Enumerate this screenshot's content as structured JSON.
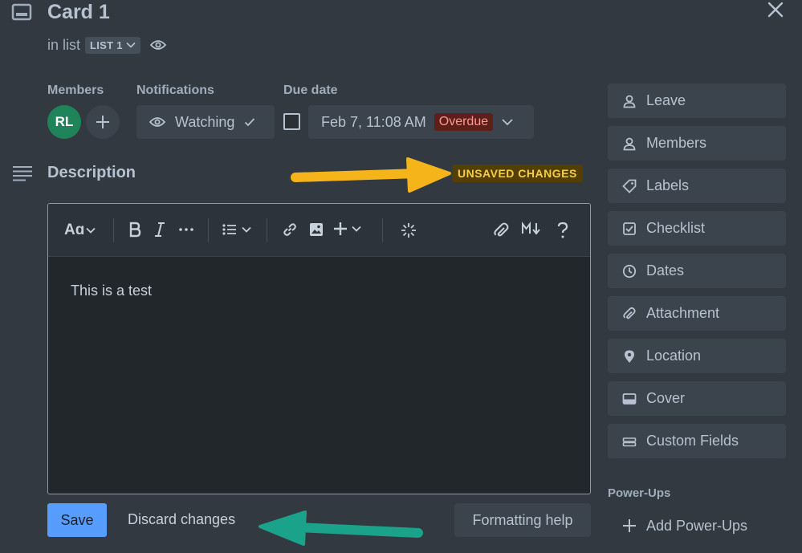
{
  "card": {
    "title": "Card 1",
    "in_list_prefix": "in list",
    "list_name": "LIST 1"
  },
  "members": {
    "label": "Members",
    "avatar_initials": "RL",
    "avatar_color": "#1f845a"
  },
  "notifications": {
    "label": "Notifications",
    "watch_label": "Watching"
  },
  "due_date": {
    "label": "Due date",
    "value": "Feb 7, 11:08 AM",
    "status": "Overdue",
    "checked": false
  },
  "description": {
    "title": "Description",
    "unsaved_badge": "UNSAVED CHANGES",
    "text": "This is a test"
  },
  "toolbar": {
    "text_style": "Aɑ",
    "items": [
      "text-style",
      "bold",
      "italic",
      "more-formatting",
      "bullet-list",
      "link",
      "image",
      "insert",
      "ai",
      "attachment",
      "markdown",
      "help"
    ]
  },
  "footer": {
    "save_label": "Save",
    "discard_label": "Discard changes",
    "help_label": "Formatting help"
  },
  "sidebar": {
    "items": [
      {
        "label": "Leave",
        "icon": "person-icon"
      },
      {
        "label": "Members",
        "icon": "person-icon"
      },
      {
        "label": "Labels",
        "icon": "tag-icon"
      },
      {
        "label": "Checklist",
        "icon": "checklist-icon"
      },
      {
        "label": "Dates",
        "icon": "clock-icon"
      },
      {
        "label": "Attachment",
        "icon": "paperclip-icon"
      },
      {
        "label": "Location",
        "icon": "pin-icon"
      },
      {
        "label": "Cover",
        "icon": "cover-icon"
      },
      {
        "label": "Custom Fields",
        "icon": "custom-fields-icon"
      }
    ],
    "powerups_label": "Power-Ups",
    "add_powerups_label": "Add Power-Ups"
  },
  "colors": {
    "background": "#323940",
    "accent": "#579dff",
    "overdue_bg": "#5d1f1a",
    "overdue_text": "#fd9891",
    "unsaved_bg": "#533f04",
    "unsaved_text": "#f5cd47",
    "annotation_yellow": "#f5b41a",
    "annotation_teal": "#1aa38a"
  }
}
